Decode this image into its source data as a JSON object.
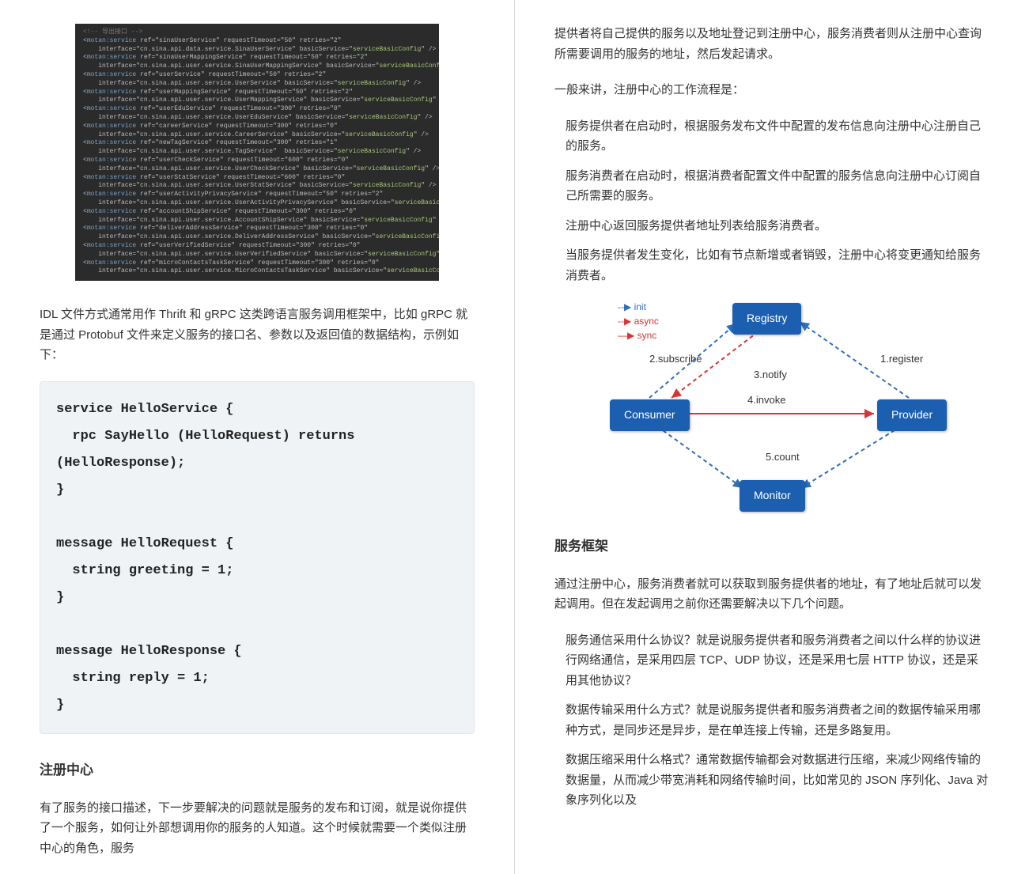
{
  "left": {
    "xml_comment": "<!-- 导出接口 -->",
    "xml_lines": [
      "<motan:service ref=\"sinaUserService\" requestTimeout=\"50\" retries=\"2\"",
      "    interface=\"cn.sina.api.data.service.SinaUserService\" basicService=\"serviceBasicConfig\" />",
      "<motan:service ref=\"sinaUserMappingService\" requestTimeout=\"50\" retries=\"2\"",
      "    interface=\"cn.sina.api.user.service.SinaUserMappingService\" basicService=\"serviceBasicConfig\" />",
      "<motan:service ref=\"userService\" requestTimeout=\"50\" retries=\"2\"",
      "    interface=\"cn.sina.api.user.service.UserService\" basicService=\"serviceBasicConfig\" />",
      "<motan:service ref=\"userMappingService\" requestTimeout=\"50\" retries=\"2\"",
      "    interface=\"cn.sina.api.user.service.UserMappingService\" basicService=\"serviceBasicConfig\" />",
      "<motan:service ref=\"userEduService\" requestTimeout=\"300\" retries=\"0\"",
      "    interface=\"cn.sina.api.user.service.UserEduService\" basicService=\"serviceBasicConfig\" />",
      "<motan:service ref=\"careerService\" requestTimeout=\"300\" retries=\"0\"",
      "    interface=\"cn.sina.api.user.service.CareerService\" basicService=\"serviceBasicConfig\" />",
      "<motan:service ref=\"newTagService\" requestTimeout=\"300\" retries=\"1\"",
      "    interface=\"cn.sina.api.user.service.TagService\"  basicService=\"serviceBasicConfig\" />",
      "<motan:service ref=\"userCheckService\" requestTimeout=\"600\" retries=\"0\"",
      "    interface=\"cn.sina.api.user.service.UserCheckService\" basicService=\"serviceBasicConfig\" />",
      "<motan:service ref=\"userStatService\" requestTimeout=\"600\" retries=\"0\"",
      "    interface=\"cn.sina.api.user.service.UserStatService\" basicService=\"serviceBasicConfig\" />",
      "<motan:service ref=\"userActivityPrivacyService\" requestTimeout=\"50\" retries=\"2\"",
      "    interface=\"cn.sina.api.user.service.UserActivityPrivacyService\" basicService=\"serviceBasicConfig\"/>",
      "<motan:service ref=\"accountShipService\" requestTimeout=\"300\" retries=\"0\"",
      "    interface=\"cn.sina.api.user.service.AccountShipService\" basicService=\"serviceBasicConfig\" />",
      "<motan:service ref=\"deliverAddressService\" requestTimeout=\"300\" retries=\"0\"",
      "    interface=\"cn.sina.api.user.service.DeliverAddressService\" basicService=\"serviceBasicConfig\" />",
      "<motan:service ref=\"userVerifiedService\" requestTimeout=\"300\" retries=\"0\"",
      "    interface=\"cn.sina.api.user.service.UserVerifiedService\" basicService=\"serviceBasicConfig\" />",
      "<motan:service ref=\"microContactsTaskService\" requestTimeout=\"300\" retries=\"0\"",
      "    interface=\"cn.sina.api.user.service.MicroContactsTaskService\" basicService=\"serviceBasicConfig\" />"
    ],
    "para_idl": "IDL 文件方式通常用作 Thrift 和 gRPC 这类跨语言服务调用框架中，比如 gRPC 就是通过 Protobuf 文件来定义服务的接口名、参数以及返回值的数据结构，示例如下：",
    "proto_code": "service HelloService {\n  rpc SayHello (HelloRequest) returns (HelloResponse);\n}\n\nmessage HelloRequest {\n  string greeting = 1;\n}\n\nmessage HelloResponse {\n  string reply = 1;\n}",
    "h_registry": "注册中心",
    "para_registry": "有了服务的接口描述，下一步要解决的问题就是服务的发布和订阅，就是说你提供了一个服务，如何让外部想调用你的服务的人知道。这个时候就需要一个类似注册中心的角色，服务"
  },
  "right": {
    "para_top": "提供者将自己提供的服务以及地址登记到注册中心，服务消费者则从注册中心查询所需要调用的服务的地址，然后发起请求。",
    "para_flow": "一般来讲，注册中心的工作流程是：",
    "flow_items": [
      "服务提供者在启动时，根据服务发布文件中配置的发布信息向注册中心注册自己的服务。",
      "服务消费者在启动时，根据消费者配置文件中配置的服务信息向注册中心订阅自己所需要的服务。",
      "注册中心返回服务提供者地址列表给服务消费者。",
      "当服务提供者发生变化，比如有节点新增或者销毁，注册中心将变更通知给服务消费者。"
    ],
    "diagram": {
      "registry": "Registry",
      "consumer": "Consumer",
      "provider": "Provider",
      "monitor": "Monitor",
      "legend_init": "init",
      "legend_async": "async",
      "legend_sync": "sync",
      "l_register": "1.register",
      "l_subscribe": "2.subscribe",
      "l_notify": "3.notify",
      "l_invoke": "4.invoke",
      "l_count": "5.count"
    },
    "h_framework": "服务框架",
    "para_framework": "通过注册中心，服务消费者就可以获取到服务提供者的地址，有了地址后就可以发起调用。但在发起调用之前你还需要解决以下几个问题。",
    "framework_items": [
      "服务通信采用什么协议？就是说服务提供者和服务消费者之间以什么样的协议进行网络通信，是采用四层 TCP、UDP 协议，还是采用七层 HTTP 协议，还是采用其他协议？",
      "数据传输采用什么方式？就是说服务提供者和服务消费者之间的数据传输采用哪种方式，是同步还是异步，是在单连接上传输，还是多路复用。",
      "数据压缩采用什么格式？通常数据传输都会对数据进行压缩，来减少网络传输的数据量，从而减少带宽消耗和网络传输时间，比如常见的 JSON 序列化、Java 对象序列化以及"
    ]
  }
}
